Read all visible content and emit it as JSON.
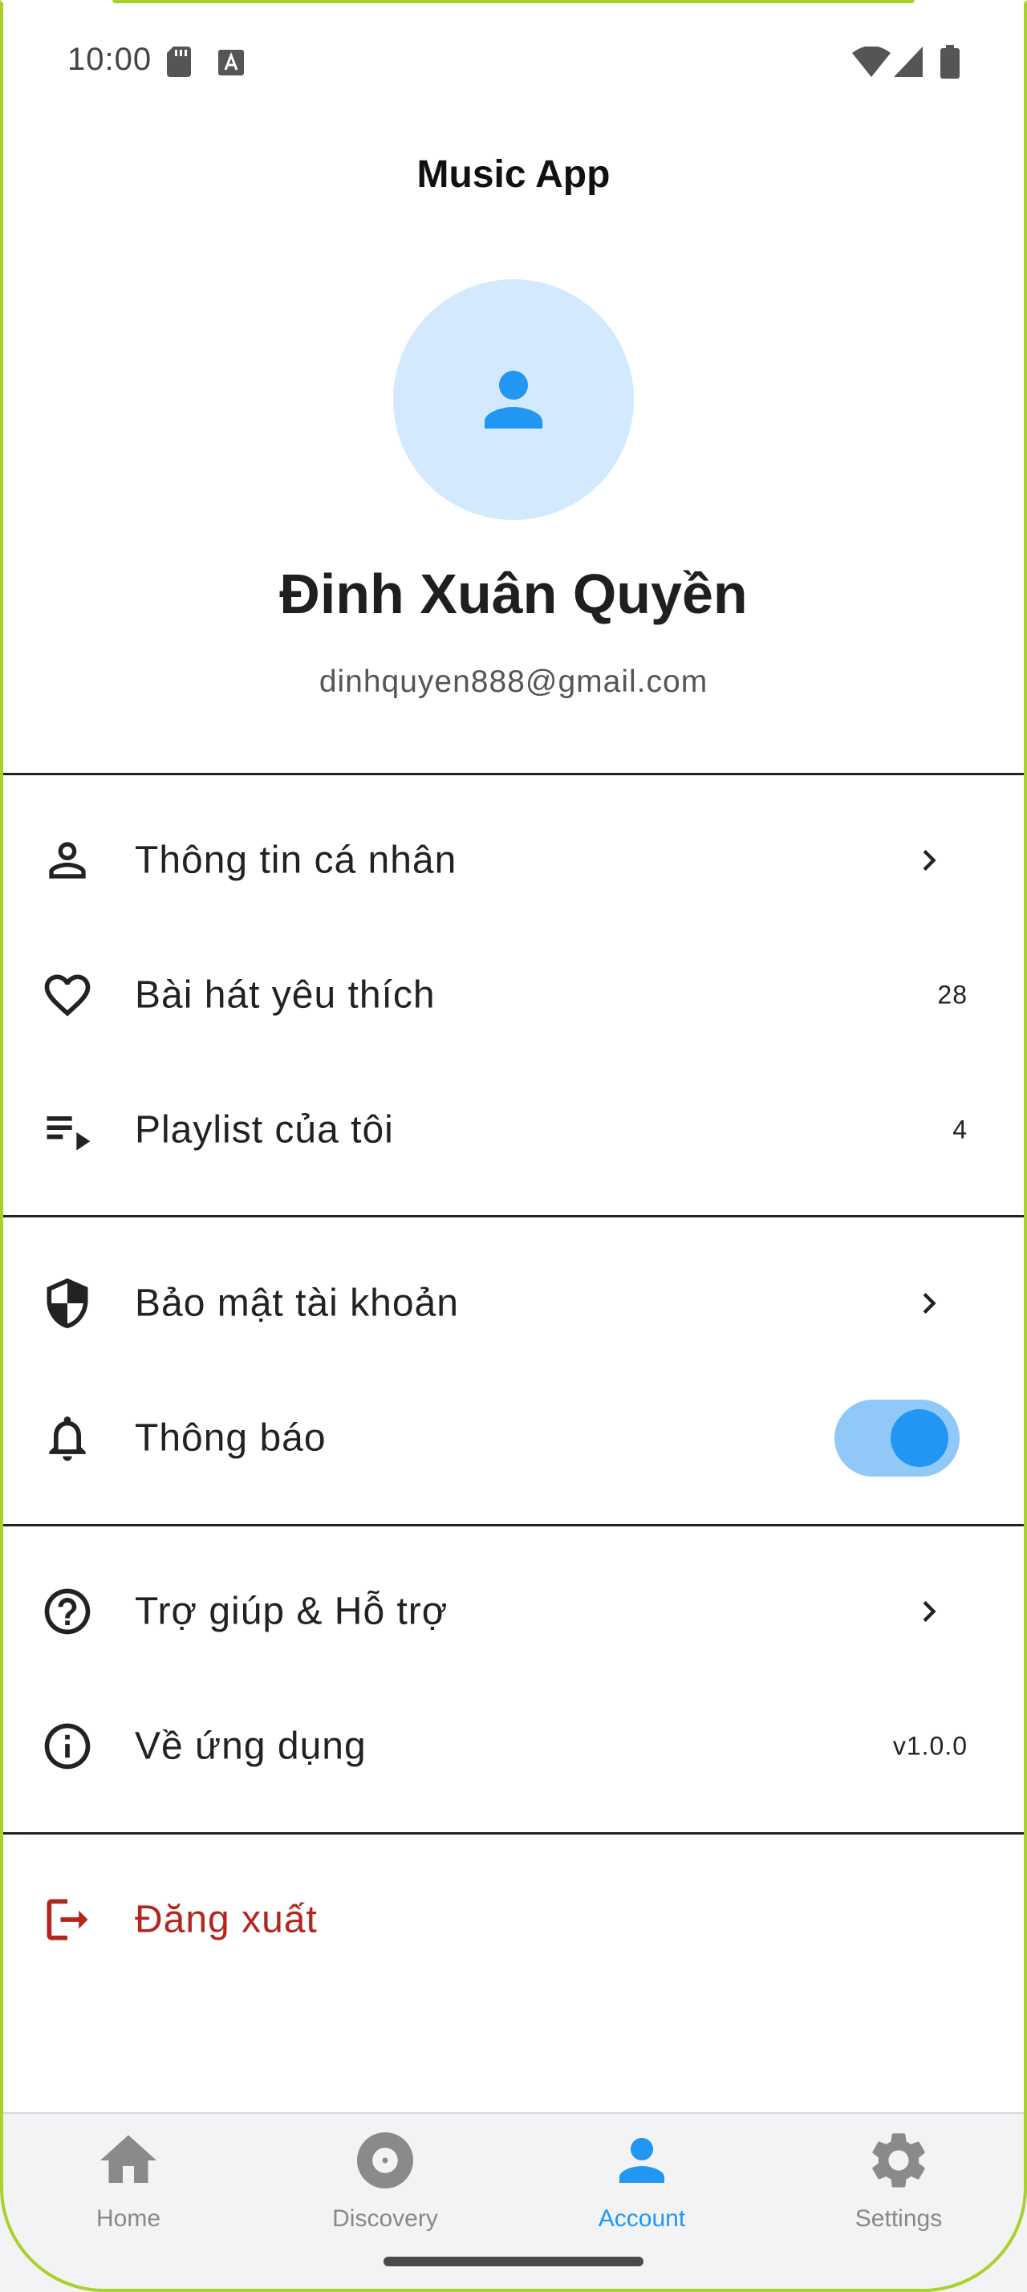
{
  "status_bar": {
    "time": "10:00"
  },
  "app_bar": {
    "title": "Music App"
  },
  "profile": {
    "name": "Đinh Xuân Quyền",
    "email": "dinhquyen888@gmail.com"
  },
  "menu": {
    "personal_info": {
      "label": "Thông tin cá nhân",
      "icon": "person-outline-icon"
    },
    "favorite_songs": {
      "label": "Bài hát yêu thích",
      "value": "28",
      "icon": "heart-outline-icon"
    },
    "my_playlists": {
      "label": "Playlist của tôi",
      "value": "4",
      "icon": "playlist-play-icon"
    },
    "account_security": {
      "label": "Bảo mật tài khoản",
      "icon": "shield-icon"
    },
    "notifications": {
      "label": "Thông báo",
      "enabled": true,
      "icon": "bell-icon"
    },
    "help_support": {
      "label": "Trợ giúp & Hỗ trợ",
      "icon": "help-circle-icon"
    },
    "about_app": {
      "label": "Về ứng dụng",
      "value": "v1.0.0",
      "icon": "info-circle-icon"
    },
    "logout": {
      "label": "Đăng xuất",
      "icon": "logout-icon"
    }
  },
  "bottom_nav": {
    "items": [
      {
        "label": "Home",
        "icon": "home-icon",
        "active": false
      },
      {
        "label": "Discovery",
        "icon": "disc-icon",
        "active": false
      },
      {
        "label": "Account",
        "icon": "account-icon",
        "active": true
      },
      {
        "label": "Settings",
        "icon": "gear-icon",
        "active": false
      }
    ]
  },
  "colors": {
    "accent": "#2196f3",
    "avatar_bg": "#d3e9fd",
    "toggle_track": "#90c9f8",
    "logout": "#b3261e",
    "frame": "#a9d12a",
    "nav_bg": "#f3f3f5"
  }
}
